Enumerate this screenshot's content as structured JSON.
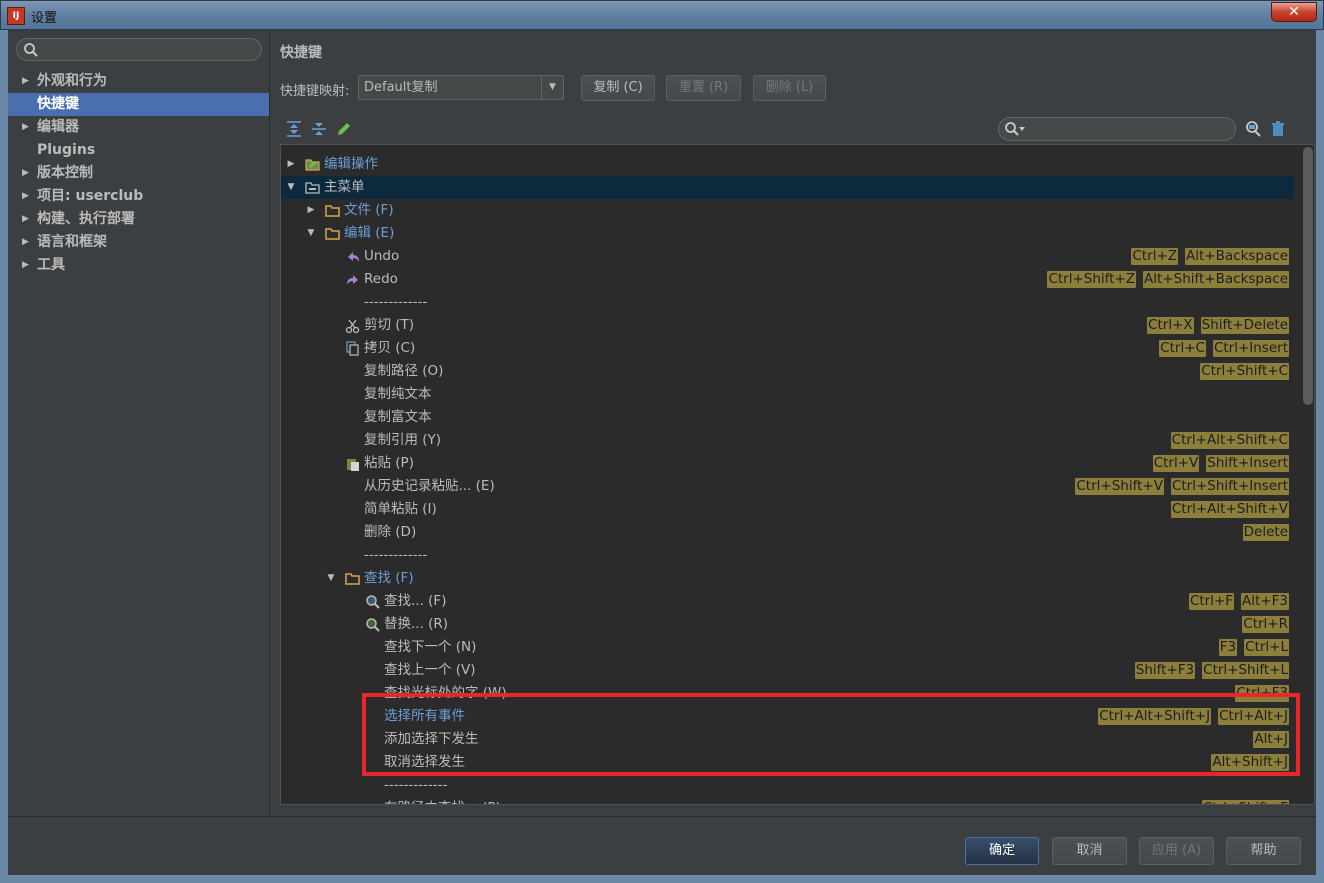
{
  "window": {
    "title": "设置",
    "close_icon": "close-icon"
  },
  "sidebar": {
    "search_placeholder": "",
    "items": [
      {
        "label": "外观和行为",
        "expandable": true
      },
      {
        "label": "快捷键",
        "expandable": false,
        "selected": true
      },
      {
        "label": "编辑器",
        "expandable": true
      },
      {
        "label": "Plugins",
        "expandable": false
      },
      {
        "label": "版本控制",
        "expandable": true
      },
      {
        "label": "项目: userclub",
        "expandable": true
      },
      {
        "label": "构建、执行部署",
        "expandable": true
      },
      {
        "label": "语言和框架",
        "expandable": true
      },
      {
        "label": "工具",
        "expandable": true
      }
    ]
  },
  "main": {
    "title": "快捷键",
    "keymap_label": "快捷键映射:",
    "keymap_value": "Default复制",
    "copy_button": "复制 (C)",
    "reset_button": "重置 (R)",
    "delete_button": "删除 (L)",
    "tree_search_placeholder": ""
  },
  "tree": {
    "rows": [
      {
        "text": "编辑操作",
        "kind": "folder-link",
        "twisty": "▶",
        "shortcuts": []
      },
      {
        "text": "主菜单",
        "kind": "folder",
        "twisty": "▼",
        "shortcuts": []
      },
      {
        "text": "文件 (F)",
        "kind": "folder-link",
        "twisty": "▶",
        "shortcuts": []
      },
      {
        "text": "编辑 (E)",
        "kind": "folder-link",
        "twisty": "▼",
        "shortcuts": []
      },
      {
        "text": "Undo",
        "kind": "action",
        "icon": "undo-icon",
        "shortcuts": [
          "Ctrl+Z",
          "Alt+Backspace"
        ]
      },
      {
        "text": "Redo",
        "kind": "action",
        "icon": "redo-icon",
        "shortcuts": [
          "Ctrl+Shift+Z",
          "Alt+Shift+Backspace"
        ]
      },
      {
        "text": "-------------",
        "kind": "separator",
        "shortcuts": []
      },
      {
        "text": "剪切 (T)",
        "kind": "action",
        "icon": "scissors-icon",
        "shortcuts": [
          "Ctrl+X",
          "Shift+Delete"
        ]
      },
      {
        "text": "拷贝 (C)",
        "kind": "action",
        "icon": "copy-icon",
        "shortcuts": [
          "Ctrl+C",
          "Ctrl+Insert"
        ]
      },
      {
        "text": "复制路径 (O)",
        "kind": "action",
        "shortcuts": [
          "Ctrl+Shift+C"
        ]
      },
      {
        "text": "复制纯文本",
        "kind": "action",
        "shortcuts": []
      },
      {
        "text": "复制富文本",
        "kind": "action",
        "shortcuts": []
      },
      {
        "text": "复制引用 (Y)",
        "kind": "action",
        "shortcuts": [
          "Ctrl+Alt+Shift+C"
        ]
      },
      {
        "text": "粘贴 (P)",
        "kind": "action",
        "icon": "paste-icon",
        "shortcuts": [
          "Ctrl+V",
          "Shift+Insert"
        ]
      },
      {
        "text": "从历史记录粘贴... (E)",
        "kind": "action",
        "shortcuts": [
          "Ctrl+Shift+V",
          "Ctrl+Shift+Insert"
        ]
      },
      {
        "text": "简单粘贴 (I)",
        "kind": "action",
        "shortcuts": [
          "Ctrl+Alt+Shift+V"
        ]
      },
      {
        "text": "删除 (D)",
        "kind": "action",
        "shortcuts": [
          "Delete"
        ]
      },
      {
        "text": "-------------",
        "kind": "separator",
        "shortcuts": []
      },
      {
        "text": "查找 (F)",
        "kind": "folder-link",
        "twisty": "▼",
        "shortcuts": []
      },
      {
        "text": "查找... (F)",
        "kind": "action",
        "icon": "find-icon",
        "shortcuts": [
          "Ctrl+F",
          "Alt+F3"
        ]
      },
      {
        "text": "替换... (R)",
        "kind": "action",
        "icon": "replace-icon",
        "shortcuts": [
          "Ctrl+R"
        ]
      },
      {
        "text": "查找下一个 (N)",
        "kind": "action",
        "shortcuts": [
          "F3",
          "Ctrl+L"
        ]
      },
      {
        "text": "查找上一个 (V)",
        "kind": "action",
        "shortcuts": [
          "Shift+F3",
          "Ctrl+Shift+L"
        ]
      },
      {
        "text": "查找光标处的字 (W)",
        "kind": "action",
        "shortcuts": [
          "Ctrl+F3"
        ]
      },
      {
        "text": "选择所有事件",
        "kind": "action-link",
        "shortcuts": [
          "Ctrl+Alt+Shift+J",
          "Ctrl+Alt+J"
        ]
      },
      {
        "text": "添加选择下发生",
        "kind": "action",
        "shortcuts": [
          "Alt+J"
        ]
      },
      {
        "text": "取消选择发生",
        "kind": "action",
        "shortcuts": [
          "Alt+Shift+J"
        ]
      },
      {
        "text": "-------------",
        "kind": "separator",
        "shortcuts": []
      },
      {
        "text": "在路径中查找... (P)",
        "kind": "action",
        "shortcuts": [
          "Ctrl+Shift+F"
        ]
      }
    ]
  },
  "footer": {
    "ok_button": "确定",
    "cancel_button": "取消",
    "apply_button": "应用 (A)",
    "help_button": "帮助"
  },
  "colors": {
    "background": "#3c3f41",
    "tree_background": "#2b2b2b",
    "selection": "#4b6eaf",
    "link": "#6a9fd8",
    "shortcut_badge": "#8c7e3b",
    "highlight_box": "#e8262c"
  }
}
